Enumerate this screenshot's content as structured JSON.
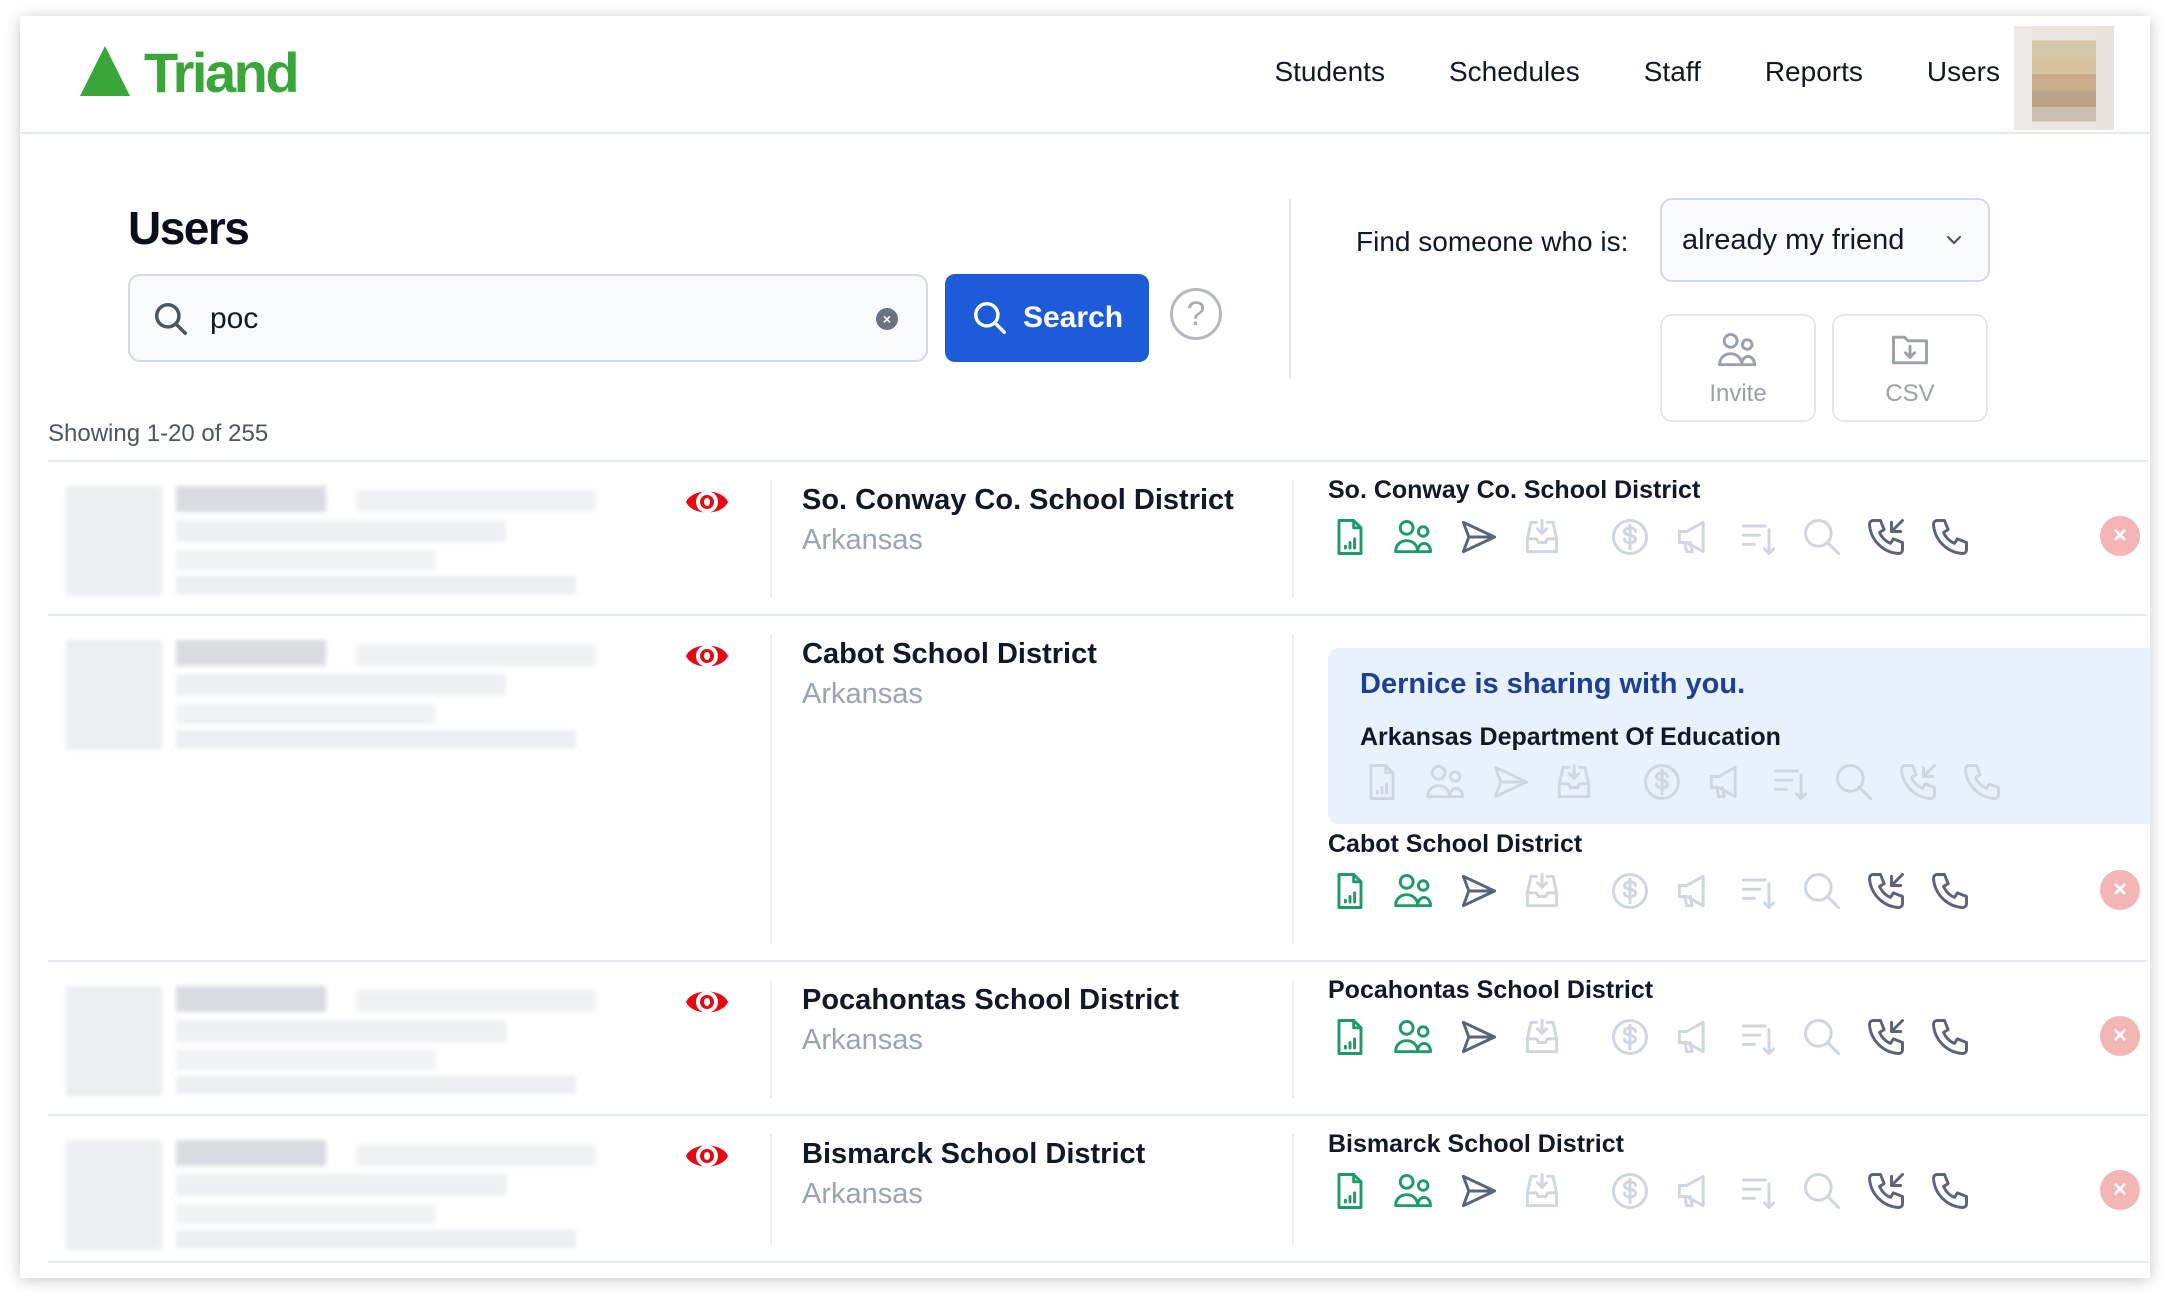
{
  "header": {
    "brand": "Triand",
    "brand_color": "#3aa63a",
    "nav": [
      "Students",
      "Schedules",
      "Staff",
      "Reports",
      "Users"
    ]
  },
  "page": {
    "title": "Users",
    "search": {
      "value": "poc",
      "placeholder": "",
      "button_label": "Search"
    },
    "filter": {
      "label": "Find someone who is:",
      "selected": "already my friend"
    },
    "actions": {
      "invite_label": "Invite",
      "csv_label": "CSV"
    },
    "showing": "Showing 1-20 of 255"
  },
  "icons": [
    "report-icon",
    "users-icon",
    "send-icon",
    "inbox-download-icon",
    "dollar-icon",
    "megaphone-icon",
    "sort-descending-icon",
    "search-icon",
    "phone-incoming-icon",
    "phone-icon"
  ],
  "rows": [
    {
      "district": "So. Conway Co. School District",
      "state": "Arkansas",
      "permissions_title": "So. Conway Co. School District",
      "icon_states": [
        "green",
        "green",
        "dark",
        "light",
        "light",
        "light",
        "light",
        "light",
        "dark",
        "dark"
      ]
    },
    {
      "district": "Cabot School District",
      "state": "Arkansas",
      "sharing": {
        "message": "Dernice is sharing with you.",
        "org": "Arkansas Department Of Education",
        "icon_states": [
          "light",
          "light",
          "light",
          "light",
          "light",
          "light",
          "light",
          "light",
          "light",
          "light"
        ]
      },
      "permissions_title": "Cabot School District",
      "icon_states": [
        "green",
        "green",
        "dark",
        "light",
        "light",
        "light",
        "light",
        "light",
        "dark",
        "dark"
      ]
    },
    {
      "district": "Pocahontas School District",
      "state": "Arkansas",
      "permissions_title": "Pocahontas School District",
      "icon_states": [
        "green",
        "green",
        "dark",
        "light",
        "light",
        "light",
        "light",
        "light",
        "dark",
        "dark"
      ]
    },
    {
      "district": "Bismarck School District",
      "state": "Arkansas",
      "permissions_title": "Bismarck School District",
      "icon_states": [
        "green",
        "green",
        "dark",
        "light",
        "light",
        "light",
        "light",
        "light",
        "dark",
        "dark"
      ]
    }
  ],
  "colors": {
    "green": "#1f9a68",
    "dark": "#5a6478",
    "light": "#cfd6e0",
    "primary": "#1d5bd8",
    "danger_soft": "#f4b5b5",
    "eye": "#e50914"
  }
}
